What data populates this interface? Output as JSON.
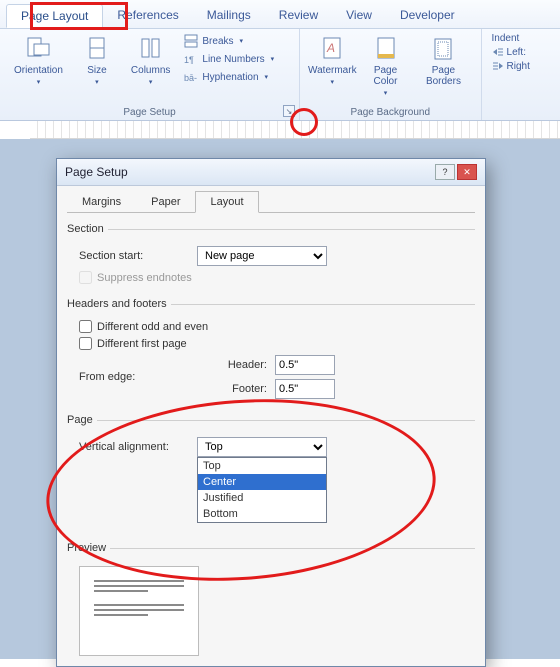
{
  "ribbon": {
    "tabs": {
      "page_layout": "Page Layout",
      "references": "References",
      "mailings": "Mailings",
      "review": "Review",
      "view": "View",
      "developer": "Developer"
    },
    "page_setup": {
      "orientation": "Orientation",
      "size": "Size",
      "columns": "Columns",
      "breaks": "Breaks",
      "line_numbers": "Line Numbers",
      "hyphenation": "Hyphenation",
      "group_label": "Page Setup"
    },
    "page_background": {
      "watermark": "Watermark",
      "page_color": "Page Color",
      "page_borders": "Page Borders",
      "group_label": "Page Background"
    },
    "paragraph": {
      "indent_label": "Indent",
      "left": "Left:",
      "right": "Right"
    }
  },
  "dialog": {
    "title": "Page Setup",
    "tabs": {
      "margins": "Margins",
      "paper": "Paper",
      "layout": "Layout"
    },
    "section": {
      "legend": "Section",
      "start_label": "Section start:",
      "start_value": "New page",
      "suppress": "Suppress endnotes"
    },
    "headers": {
      "legend": "Headers and footers",
      "diff_odd_even": "Different odd and even",
      "diff_first": "Different first page",
      "from_edge": "From edge:",
      "header_label": "Header:",
      "header_value": "0.5\"",
      "footer_label": "Footer:",
      "footer_value": "0.5\""
    },
    "page": {
      "legend": "Page",
      "va_label": "Vertical alignment:",
      "va_value": "Top",
      "va_options": {
        "top": "Top",
        "center": "Center",
        "justified": "Justified",
        "bottom": "Bottom"
      }
    },
    "preview": {
      "legend": "Preview"
    }
  }
}
